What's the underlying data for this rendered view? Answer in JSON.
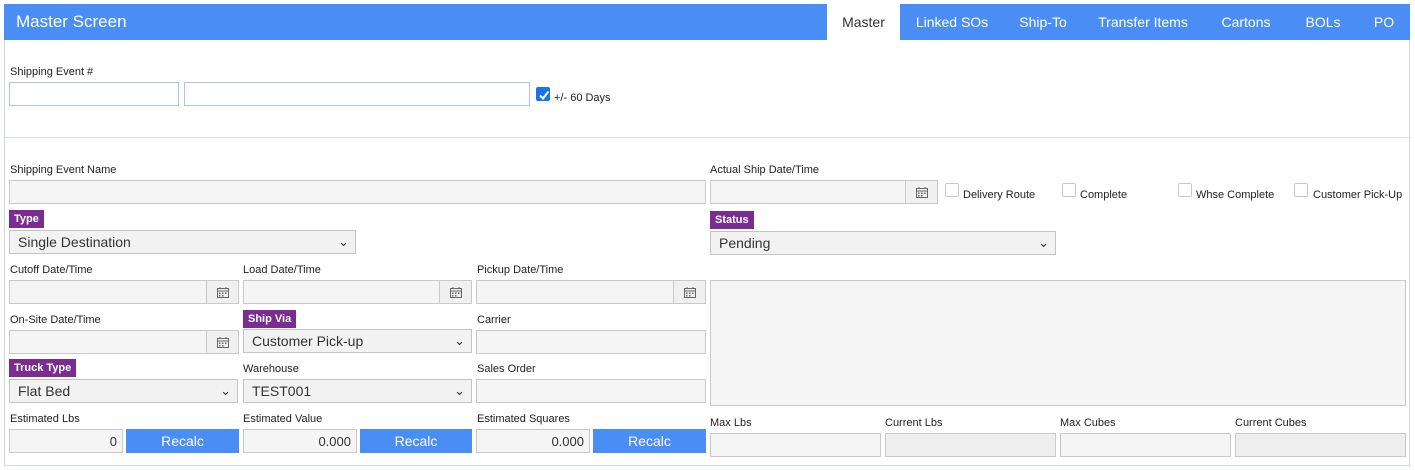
{
  "header": {
    "title": "Master Screen",
    "tabs": [
      "Master",
      "Linked SOs",
      "Ship-To",
      "Transfer Items",
      "Cartons",
      "BOLs",
      "PO"
    ],
    "accent": "#4a8ef5"
  },
  "search": {
    "label": "Shipping Event #",
    "field1_value": "",
    "field2_value": "",
    "days_label": "+/- 60 Days",
    "days_checked": true
  },
  "form": {
    "name_label": "Shipping Event Name",
    "name_value": "",
    "type_label": "Type",
    "type_value": "Single Destination",
    "status_label": "Status",
    "status_value": "Pending",
    "actual_ship_label": "Actual Ship Date/Time",
    "actual_ship_value": "",
    "flags": [
      {
        "label": "Delivery Route",
        "checked": false
      },
      {
        "label": "Complete",
        "checked": false
      },
      {
        "label": "Whse Complete",
        "checked": false
      },
      {
        "label": "Customer Pick-Up",
        "checked": false
      }
    ],
    "cutoff_label": "Cutoff Date/Time",
    "load_label": "Load Date/Time",
    "pickup_label": "Pickup Date/Time",
    "onsite_label": "On-Site Date/Time",
    "ship_via_label": "Ship Via",
    "ship_via_value": "Customer Pick-up",
    "carrier_label": "Carrier",
    "carrier_value": "",
    "truck_type_label": "Truck Type",
    "truck_type_value": "Flat Bed",
    "warehouse_label": "Warehouse",
    "warehouse_value": "TEST001",
    "sales_order_label": "Sales Order",
    "sales_order_value": "",
    "est_lbs_label": "Estimated Lbs",
    "est_lbs_value": "0",
    "est_value_label": "Estimated Value",
    "est_value_value": "0.000",
    "est_squares_label": "Estimated Squares",
    "est_squares_value": "0.000",
    "recalc_label": "Recalc",
    "max_lbs_label": "Max Lbs",
    "current_lbs_label": "Current Lbs",
    "max_cubes_label": "Max Cubes",
    "current_cubes_label": "Current Cubes",
    "badge_color": "#7b2c91"
  },
  "icons": {
    "calendar": "calendar-icon",
    "chevron": "chevron-down-icon",
    "check": "check-icon"
  }
}
